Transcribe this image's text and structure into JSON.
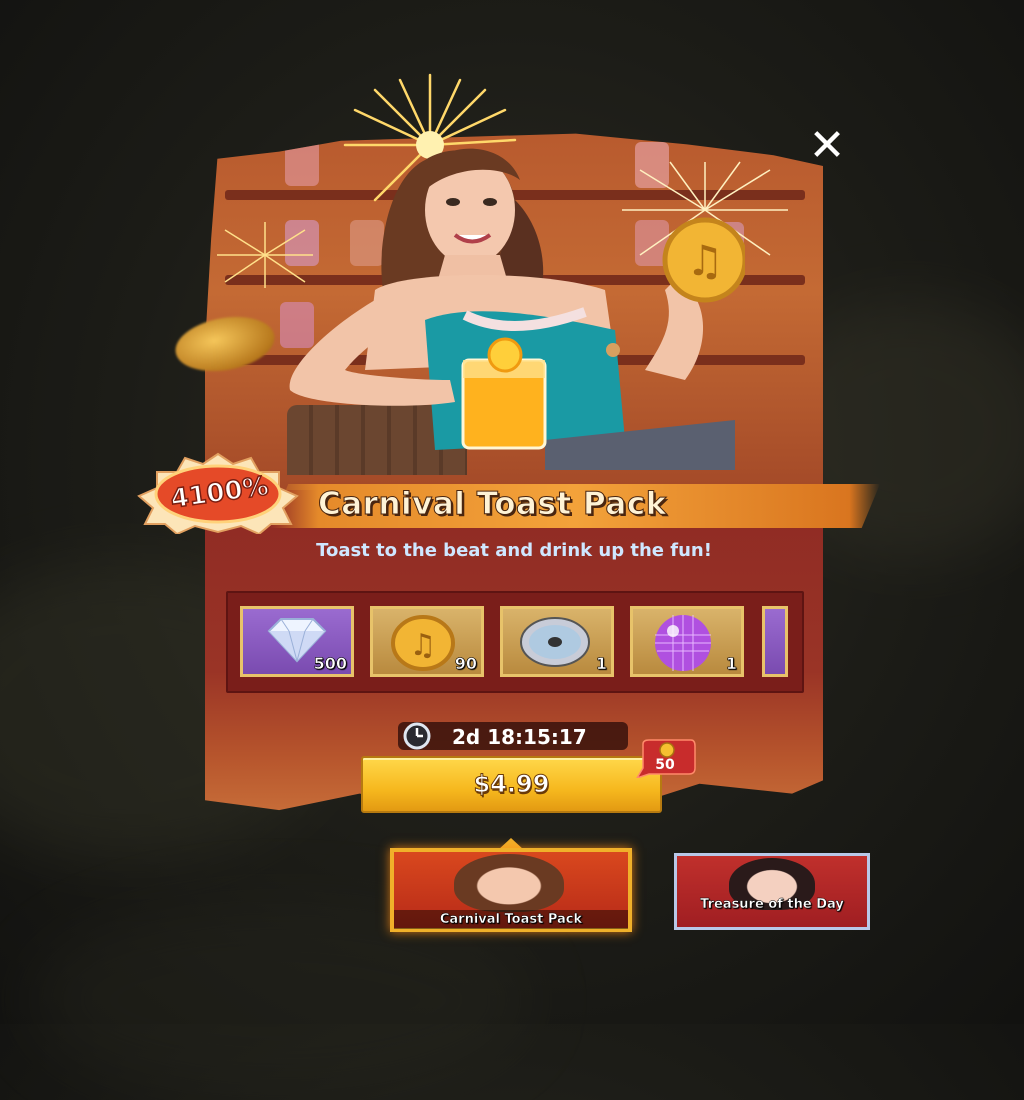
{
  "offer": {
    "title": "Carnival Toast Pack",
    "subtitle": "Toast to the beat and drink up the fun!",
    "discount_badge": "4100%",
    "timer": "2d 18:15:17",
    "price": "$4.99",
    "bonus_points": "50"
  },
  "rewards": [
    {
      "icon": "diamond-icon",
      "count": "500"
    },
    {
      "icon": "music-coin-icon",
      "count": "90"
    },
    {
      "icon": "cd-disc-icon",
      "count": "1"
    },
    {
      "icon": "disco-ball-icon",
      "count": "1"
    }
  ],
  "tabs": [
    {
      "label": "Carnival Toast Pack",
      "active": true
    },
    {
      "label": "Treasure of the Day",
      "active": false
    }
  ],
  "colors": {
    "buy_button": "#f6b81e",
    "panel_red": "#8e2a24",
    "title_banner": "#f3a23a",
    "active_tab_border": "#f0b02a"
  }
}
